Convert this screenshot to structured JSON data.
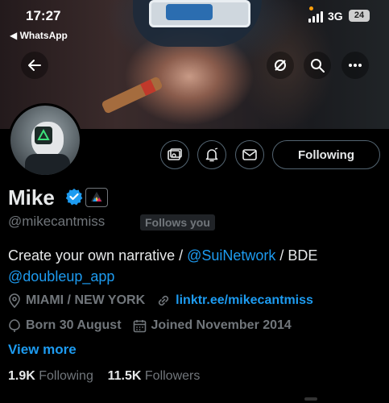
{
  "status_bar": {
    "time": "17:27",
    "back_app": "◀ WhatsApp",
    "network": "3G",
    "battery": "24"
  },
  "profile": {
    "name": "Mike",
    "handle": "@mikecantmiss",
    "follows_you": "Follows you",
    "following_button": "Following",
    "bio": {
      "part1": "Create your own narrative / ",
      "mention1": "@SuiNetwork",
      "part2": " / BDE",
      "mention2": "@doubleup_app"
    },
    "location": "MIAMI / NEW YORK",
    "website": "linktr.ee/mikecantmiss",
    "birthday": "Born 30 August",
    "joined": "Joined November 2014",
    "view_more": "View more",
    "following_count": "1.9K",
    "following_label": "Following",
    "followers_count": "11.5K",
    "followers_label": "Followers"
  },
  "colors": {
    "accent": "#1d9bf0",
    "muted": "#71767b",
    "background": "#000000"
  },
  "icons": [
    "back-arrow-icon",
    "sync-icon",
    "search-icon",
    "more-icon",
    "subscriptions-icon",
    "notifications-bell-icon",
    "message-icon",
    "verified-badge-icon",
    "affiliate-badge-icon",
    "location-icon",
    "link-icon",
    "birthday-icon",
    "calendar-icon"
  ]
}
